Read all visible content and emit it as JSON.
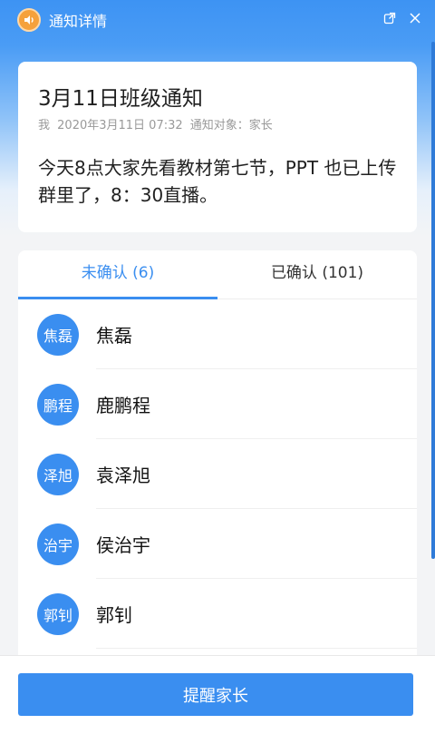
{
  "window": {
    "title": "通知详情",
    "icons": {
      "app": "speaker-icon",
      "popout": "popout-icon",
      "close": "close-icon"
    }
  },
  "notice": {
    "title": "3月11日班级通知",
    "author": "我",
    "datetime": "2020年3月11日 07:32",
    "audience_label": "通知对象：家长",
    "body": "今天8点大家先看教材第七节，PPT 也已上传群里了，8：30直播。"
  },
  "tabs": [
    {
      "label": "未确认 (6)",
      "active": true
    },
    {
      "label": "已确认 (101)",
      "active": false
    }
  ],
  "members": [
    {
      "avatar_text": "焦磊",
      "name": "焦磊"
    },
    {
      "avatar_text": "鹏程",
      "name": "鹿鹏程"
    },
    {
      "avatar_text": "泽旭",
      "name": "袁泽旭"
    },
    {
      "avatar_text": "治宇",
      "name": "侯治宇"
    },
    {
      "avatar_text": "郭钊",
      "name": "郭钊"
    }
  ],
  "footer": {
    "remind_label": "提醒家长"
  },
  "colors": {
    "accent": "#3a8ef0",
    "header_blue": "#3d93f3",
    "app_icon": "#f5a13c"
  }
}
